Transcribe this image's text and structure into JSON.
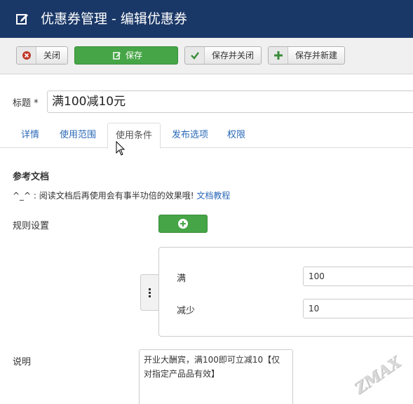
{
  "header": {
    "title": "优惠券管理 - 编辑优惠券",
    "icon": "edit-icon"
  },
  "toolbar": {
    "close_label": "关闭",
    "save_label": "保存",
    "save_close_label": "保存并关闭",
    "save_new_label": "保存并新建"
  },
  "form": {
    "title_label": "标题 *",
    "title_value": "满100减10元"
  },
  "tabs": [
    {
      "label": "详情"
    },
    {
      "label": "使用范围"
    },
    {
      "label": "使用条件"
    },
    {
      "label": "发布选项"
    },
    {
      "label": "权限"
    }
  ],
  "active_tab": "使用条件",
  "reference": {
    "heading": "参考文档",
    "text": "^_^ : 阅读文档后再使用会有事半功倍的效果哦!",
    "link": "文档教程"
  },
  "rules": {
    "label": "规则设置",
    "items": [
      {
        "label": "满",
        "value": "100"
      },
      {
        "label": "减少",
        "value": "10"
      }
    ]
  },
  "description": {
    "label": "说明",
    "value": "开业大酬宾，满100即可立减10【仅对指定产品品有效】"
  },
  "watermark": "ZMAX",
  "colors": {
    "header_bg": "#1a3867",
    "primary_green": "#46a546",
    "link_blue": "#2a69b8",
    "close_red": "#c0392b"
  }
}
